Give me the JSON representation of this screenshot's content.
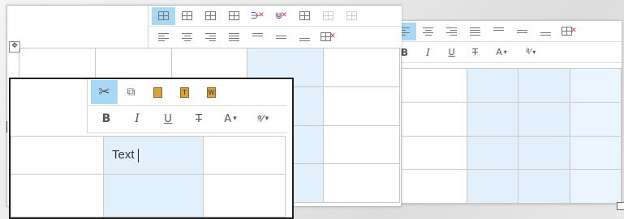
{
  "front_toolbar": {
    "row1": [
      "cut-icon",
      "copy-icon",
      "paste-icon",
      "paste-text-icon",
      "paste-word-icon"
    ],
    "bold": "B",
    "italic": "I",
    "underline": "U",
    "strike": "T",
    "fontcolor": "A",
    "fontcolor_caret": "▾",
    "format": "ª⁄",
    "format_caret": "▾"
  },
  "front_table": {
    "text_cell": "Text"
  },
  "mid_toolbar": {
    "row1": [
      "table-select-icon",
      "table-props-icon",
      "insert-col-icon",
      "insert-row-icon",
      "delete-col-icon",
      "delete-row-icon",
      "merge-cells-icon",
      "split-cells-icon",
      "cell-props-icon"
    ],
    "row2": [
      "align-left-icon",
      "align-center-icon",
      "align-right-icon",
      "align-justify-icon",
      "valign-top-icon",
      "valign-middle-icon",
      "valign-bottom-icon",
      "delete-table-icon"
    ]
  },
  "right_toolbar": {
    "bold": "B",
    "italic": "I",
    "underline": "U",
    "strike": "T",
    "fontcolor": "A",
    "fontcolor_caret": "▾",
    "format": "ª⁄",
    "format_caret": "▾"
  },
  "colors": {
    "active_button": "#a8d8f6",
    "cell_highlight": "#e2f0fb"
  }
}
